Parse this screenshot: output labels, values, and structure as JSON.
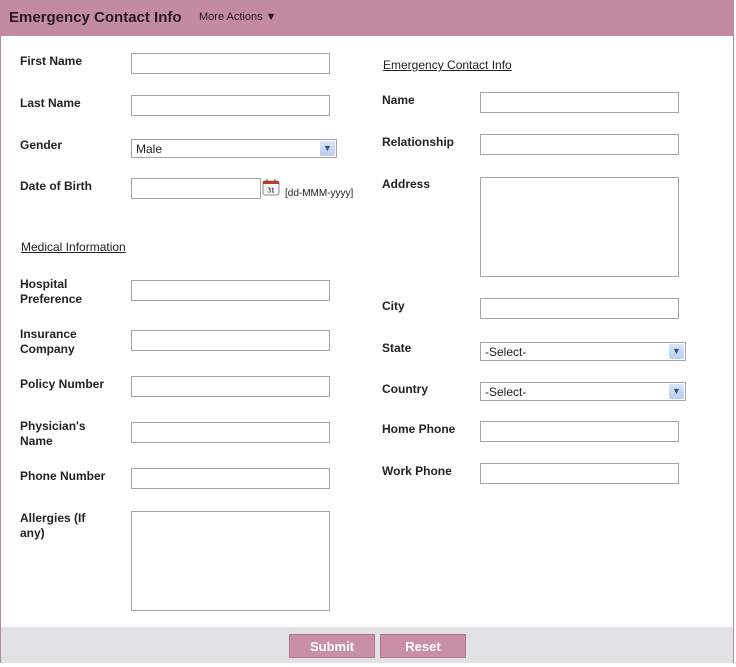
{
  "header": {
    "title": "Emergency Contact Info",
    "more_actions": "More Actions ▼"
  },
  "left": {
    "first_name": {
      "label": "First Name",
      "value": ""
    },
    "last_name": {
      "label": "Last Name",
      "value": ""
    },
    "gender": {
      "label": "Gender",
      "value": "Male"
    },
    "dob": {
      "label": "Date of Birth",
      "value": "",
      "format_hint": "[dd-MMM-yyyy]",
      "calendar_icon_text": "31"
    },
    "medical_section": "Medical Information",
    "hospital": {
      "label_line1": "Hospital",
      "label_line2": "Preference",
      "value": ""
    },
    "insurance": {
      "label_line1": "Insurance",
      "label_line2": "Company",
      "value": ""
    },
    "policy": {
      "label": "Policy Number",
      "value": ""
    },
    "physician": {
      "label_line1": "Physician's",
      "label_line2": "Name",
      "value": ""
    },
    "phone": {
      "label": "Phone Number",
      "value": ""
    },
    "allergies": {
      "label_line1": "Allergies (If",
      "label_line2": "any)",
      "value": ""
    }
  },
  "right": {
    "section": "Emergency Contact Info",
    "name": {
      "label": "Name",
      "value": ""
    },
    "relationship": {
      "label": "Relationship",
      "value": ""
    },
    "address": {
      "label": "Address",
      "value": ""
    },
    "city": {
      "label": "City",
      "value": ""
    },
    "state": {
      "label": "State",
      "value": "-Select-"
    },
    "country": {
      "label": "Country",
      "value": "-Select-"
    },
    "home_phone": {
      "label": "Home Phone",
      "value": ""
    },
    "work_phone": {
      "label": "Work Phone",
      "value": ""
    }
  },
  "footer": {
    "submit": "Submit",
    "reset": "Reset"
  },
  "colors": {
    "header_bg": "#c38ba3",
    "button_bg": "#c98ea8",
    "footer_bg": "#e2e1e3"
  }
}
